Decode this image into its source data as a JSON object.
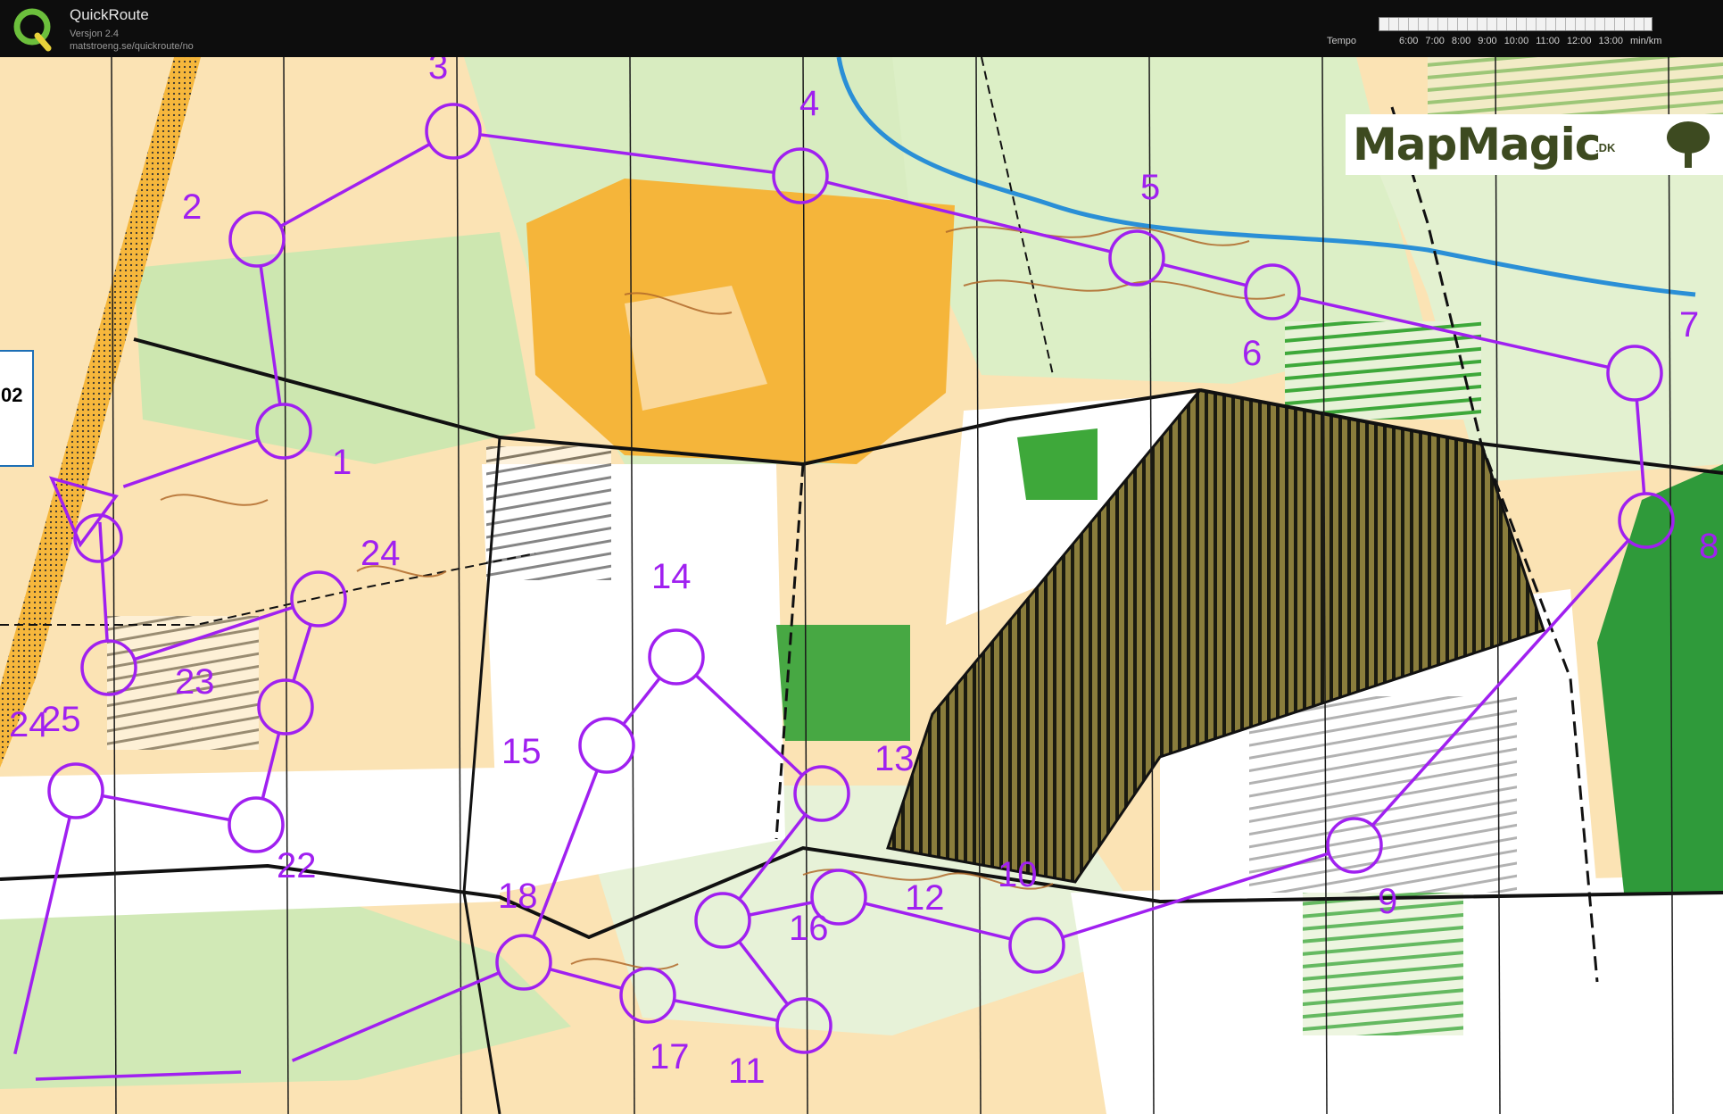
{
  "app": {
    "logo_glyph": "Q",
    "title": "QuickRoute",
    "version": "Versjon 2.4",
    "url": "matstroeng.se/quickroute/no"
  },
  "tempo": {
    "label": "Tempo",
    "ticks": [
      "6:00",
      "7:00",
      "8:00",
      "9:00",
      "10:00",
      "11:00",
      "12:00",
      "13:00",
      "min/km"
    ]
  },
  "map": {
    "brand": "MapMagic",
    "brand_suffix": ".DK",
    "side_label": "02",
    "course_color": "#a020f0",
    "controls": [
      {
        "label": "1"
      },
      {
        "label": "2"
      },
      {
        "label": "3"
      },
      {
        "label": "4"
      },
      {
        "label": "5"
      },
      {
        "label": "6"
      },
      {
        "label": "7"
      },
      {
        "label": "8"
      },
      {
        "label": "9"
      },
      {
        "label": "10"
      },
      {
        "label": "11"
      },
      {
        "label": "12"
      },
      {
        "label": "13"
      },
      {
        "label": "14"
      },
      {
        "label": "15"
      },
      {
        "label": "16"
      },
      {
        "label": "17"
      },
      {
        "label": "18"
      },
      {
        "label": "22"
      },
      {
        "label": "23"
      },
      {
        "label": "24"
      },
      {
        "label": "24"
      },
      {
        "label": "25"
      }
    ]
  }
}
